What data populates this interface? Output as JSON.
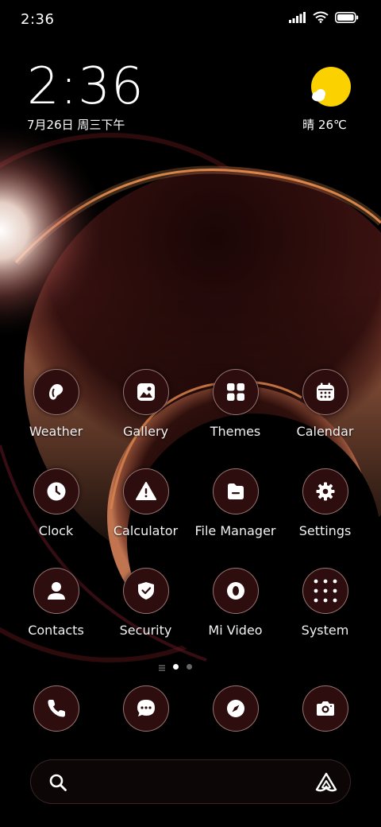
{
  "status_bar": {
    "time": "2:36",
    "icons": [
      "signal-icon",
      "wifi-icon",
      "battery-icon"
    ]
  },
  "clock_widget": {
    "time": "2:36",
    "date": "7月26日 周三下午"
  },
  "weather_widget": {
    "icon": "sun-cloud-icon",
    "condition_temp": "晴 26℃"
  },
  "apps": [
    {
      "label": "Weather",
      "icon": "weather-drop-icon"
    },
    {
      "label": "Gallery",
      "icon": "gallery-icon"
    },
    {
      "label": "Themes",
      "icon": "themes-icon"
    },
    {
      "label": "Calendar",
      "icon": "calendar-icon"
    },
    {
      "label": "Clock",
      "icon": "clock-icon"
    },
    {
      "label": "Calculator",
      "icon": "calculator-icon"
    },
    {
      "label": "File Manager",
      "icon": "folder-icon"
    },
    {
      "label": "Settings",
      "icon": "gear-icon"
    },
    {
      "label": "Contacts",
      "icon": "contacts-icon"
    },
    {
      "label": "Security",
      "icon": "shield-icon"
    },
    {
      "label": "Mi Video",
      "icon": "video-icon"
    },
    {
      "label": "System",
      "icon": "system-folder-icon"
    }
  ],
  "page_indicator": {
    "pages": 2,
    "active": 1
  },
  "dock": [
    {
      "icon": "phone-icon"
    },
    {
      "icon": "message-icon"
    },
    {
      "icon": "browser-compass-icon"
    },
    {
      "icon": "camera-icon"
    }
  ],
  "search_bar": {
    "left_icon": "search-icon",
    "right_icon": "assistant-icon"
  },
  "colors": {
    "icon_bg": "#2d0d0d",
    "icon_border": "#be9691",
    "sun": "#fbd100",
    "planet_glow": "#e0783a"
  }
}
